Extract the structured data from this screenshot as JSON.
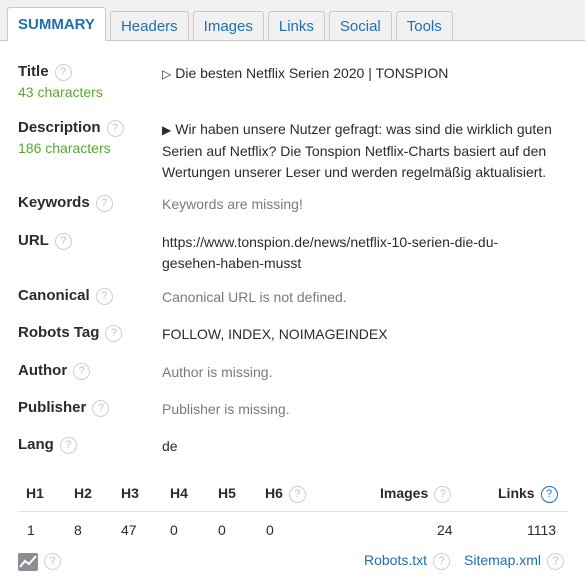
{
  "tabs": [
    "SUMMARY",
    "Headers",
    "Images",
    "Links",
    "Social",
    "Tools"
  ],
  "help_glyph": "?",
  "title": {
    "label": "Title",
    "count": "43 characters",
    "symbol": "▷",
    "value": "Die besten Netflix Serien 2020 | TONSPION"
  },
  "description": {
    "label": "Description",
    "count": "186 characters",
    "symbol": "▶",
    "value": "Wir haben unsere Nutzer gefragt: was sind die wirklich guten Serien auf Netflix? Die Tonspion Netflix-Charts basiert auf den Wertungen unserer Leser und werden regelmäßig aktualisiert."
  },
  "keywords": {
    "label": "Keywords",
    "value": "Keywords are missing!"
  },
  "url": {
    "label": "URL",
    "value": "https://www.tonspion.de/news/netflix-10-serien-die-du-gesehen-haben-musst"
  },
  "canonical": {
    "label": "Canonical",
    "value": "Canonical URL is not defined."
  },
  "robots": {
    "label": "Robots Tag",
    "value": "FOLLOW, INDEX, NOIMAGEINDEX"
  },
  "author": {
    "label": "Author",
    "value": "Author is missing."
  },
  "publisher": {
    "label": "Publisher",
    "value": "Publisher is missing."
  },
  "lang": {
    "label": "Lang",
    "value": "de"
  },
  "stats": {
    "headers": [
      "H1",
      "H2",
      "H3",
      "H4",
      "H5",
      "H6"
    ],
    "header_counts": [
      "1",
      "8",
      "47",
      "0",
      "0",
      "0"
    ],
    "images_label": "Images",
    "images_count": "24",
    "links_label": "Links",
    "links_count": "1113"
  },
  "footer": {
    "robots_link": "Robots.txt",
    "sitemap_link": "Sitemap.xml",
    "chart_icon": "line-chart-icon"
  },
  "colors": {
    "link": "#1f6fb2",
    "count_green": "#58a72f",
    "muted": "#7a7a7a"
  }
}
